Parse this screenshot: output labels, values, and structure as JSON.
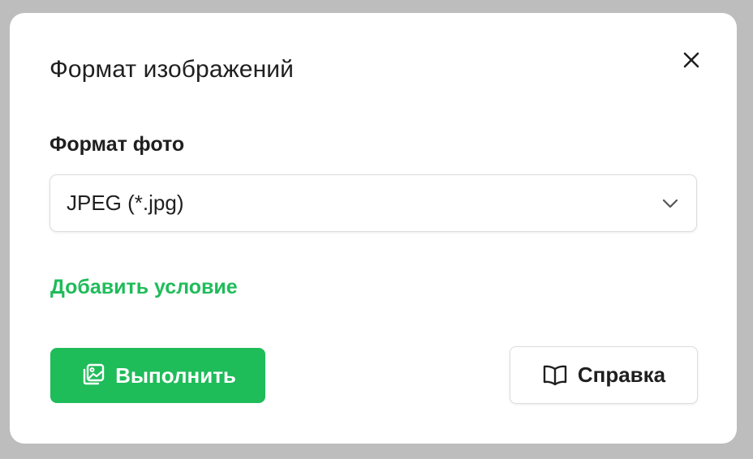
{
  "dialog": {
    "title": "Формат изображений",
    "close_icon": "close-icon"
  },
  "photo_format": {
    "label": "Формат фото",
    "selected_value": "JPEG (*.jpg)",
    "chevron_icon": "chevron-down-icon"
  },
  "add_condition": {
    "label": "Добавить условие"
  },
  "buttons": {
    "run": {
      "label": "Выполнить",
      "icon": "images-icon"
    },
    "help": {
      "label": "Справка",
      "icon": "book-icon"
    }
  },
  "colors": {
    "accent": "#1fbc5a",
    "text": "#1f1f1f",
    "backdrop": "#bdbdbd",
    "border": "#dcdcdc"
  }
}
